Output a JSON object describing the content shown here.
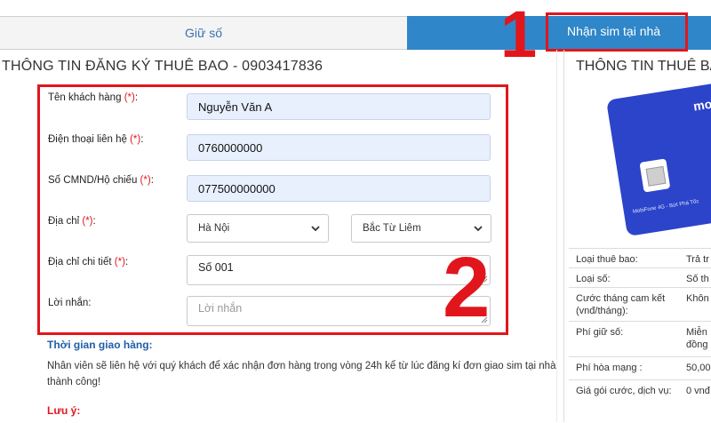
{
  "tabs": {
    "keep_number": "Giữ số",
    "deliver_home": "Nhận sim tại nhà"
  },
  "annotations": {
    "step1": "1",
    "step2": "2"
  },
  "form": {
    "title": "THÔNG TIN ĐĂNG KÝ THUÊ BAO - 0903417836",
    "required_mark": "(*)",
    "customer_name": {
      "label": "Tên khách hàng",
      "value": "Nguyễn Văn A"
    },
    "phone": {
      "label": "Điện thoại liên hệ",
      "value": "0760000000"
    },
    "id_number": {
      "label": "Số CMND/Hộ chiếu",
      "value": "077500000000"
    },
    "address": {
      "label": "Địa chỉ",
      "province": "Hà Nội",
      "district": "Bắc Từ Liêm"
    },
    "address_detail": {
      "label": "Địa chỉ chi tiết",
      "value": "Số 001"
    },
    "message": {
      "label": "Lời nhắn:",
      "placeholder": "Lời nhắn"
    }
  },
  "delivery": {
    "heading": "Thời gian giao hàng:",
    "text": "Nhân viên sẽ liên hệ với quý khách để xác nhận đơn hàng trong vòng 24h kể từ lúc đăng kí đơn giao sim tại nhà thành công!",
    "note_heading": "Lưu ý:"
  },
  "summary": {
    "title": "THÔNG TIN THUÊ BAO",
    "sim_brand": "mo",
    "sim_strip": "MobiFone 4G - Bứt Phá Tốc",
    "rows": [
      {
        "key": "Loại thuê bao:",
        "value": "Trả tr"
      },
      {
        "key": "Loại số:",
        "value": "Số th"
      },
      {
        "key": "Cước tháng cam kết (vnđ/tháng):",
        "value": "Khôn"
      },
      {
        "key": "Phí giữ số:",
        "value": "Miễn",
        "value2": "đồng"
      },
      {
        "key": "Phí hòa mạng :",
        "value": "50,00"
      },
      {
        "key": "Giá gói cước, dịch vụ:",
        "value": "0 vnđ"
      }
    ]
  },
  "colors": {
    "accent_blue": "#2f86c8",
    "highlight_red": "#e0161c",
    "link_blue": "#1f5fa7"
  }
}
